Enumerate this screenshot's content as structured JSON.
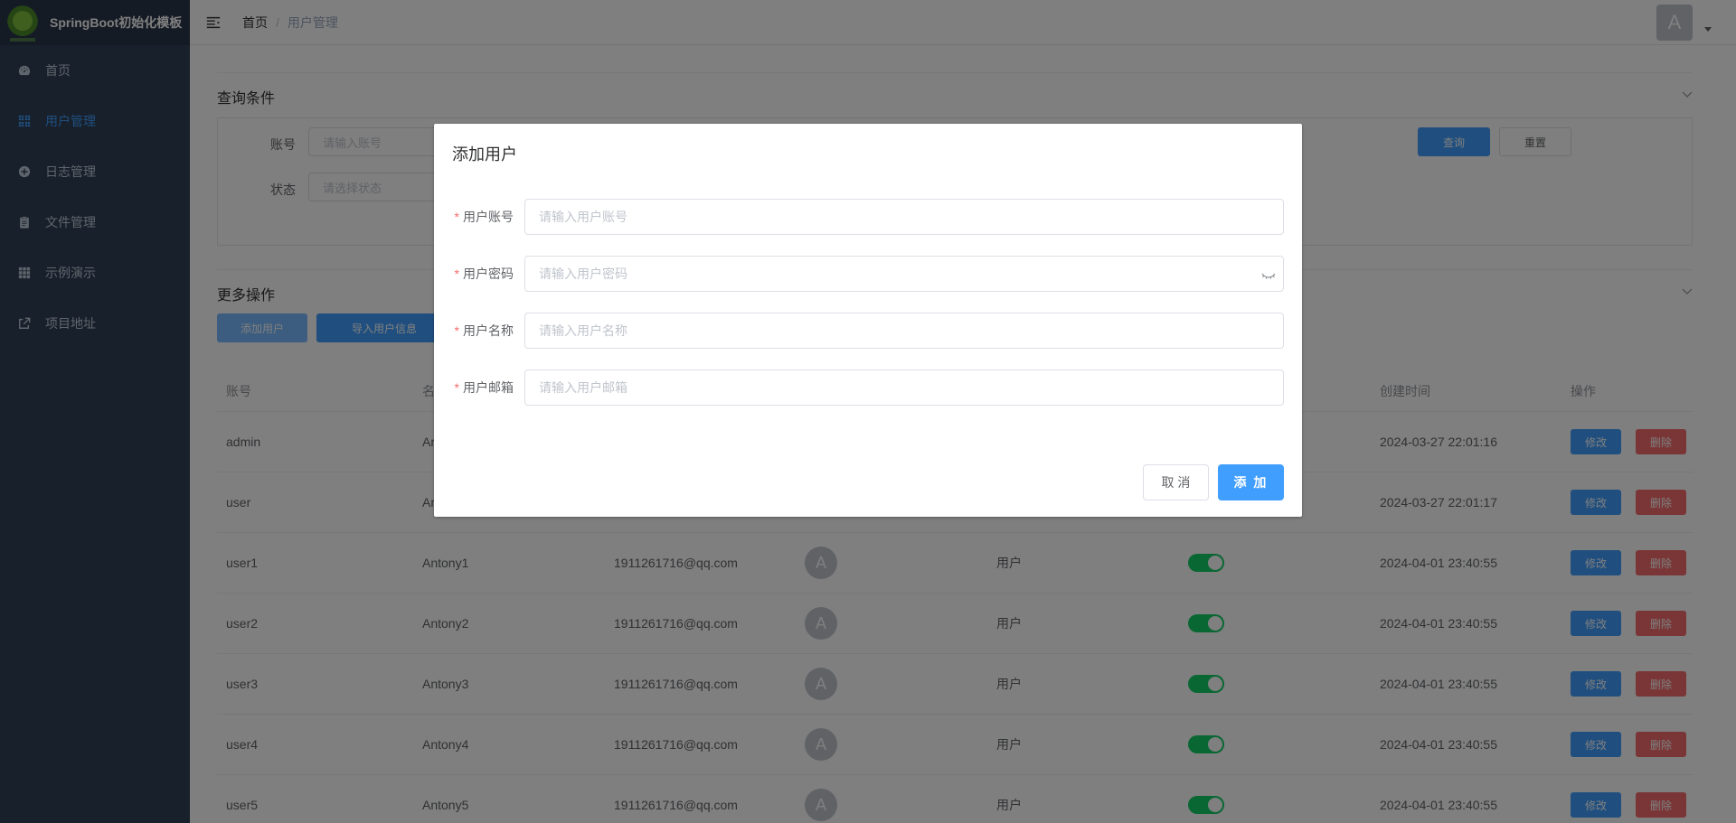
{
  "app": {
    "title": "SpringBoot初始化模板"
  },
  "sidebar": {
    "items": [
      {
        "label": "首页",
        "icon": "dashboard-icon",
        "active": false
      },
      {
        "label": "用户管理",
        "icon": "grid-icon",
        "active": true
      },
      {
        "label": "日志管理",
        "icon": "circle-plus-icon",
        "active": false
      },
      {
        "label": "文件管理",
        "icon": "clipboard-icon",
        "active": false
      },
      {
        "label": "示例演示",
        "icon": "apps-icon",
        "active": false
      },
      {
        "label": "项目地址",
        "icon": "external-link-icon",
        "active": false
      }
    ]
  },
  "header": {
    "breadcrumb": {
      "home": "首页",
      "separator": "/",
      "current": "用户管理"
    },
    "avatar_letter": "A"
  },
  "query": {
    "title": "查询条件",
    "account_label": "账号",
    "account_placeholder": "请输入账号",
    "status_label": "状态",
    "status_placeholder": "请选择状态",
    "search_button": "查询",
    "reset_button": "重置"
  },
  "more_ops": {
    "title": "更多操作",
    "add_user_button": "添加用户",
    "import_button": "导入用户信息"
  },
  "table": {
    "headers": [
      "账号",
      "名",
      "",
      "",
      "",
      "",
      "创建时间",
      "操作"
    ],
    "edit_label": "修改",
    "delete_label": "删除",
    "rows": [
      {
        "account": "admin",
        "name": "Ar",
        "email": "",
        "avatar": "",
        "role": "",
        "created": "2024-03-27 22:01:16"
      },
      {
        "account": "user",
        "name": "Ar",
        "email": "",
        "avatar": "",
        "role": "",
        "created": "2024-03-27 22:01:17"
      },
      {
        "account": "user1",
        "name": "Antony1",
        "email": "1911261716@qq.com",
        "avatar": "A",
        "role": "用户",
        "created": "2024-04-01 23:40:55"
      },
      {
        "account": "user2",
        "name": "Antony2",
        "email": "1911261716@qq.com",
        "avatar": "A",
        "role": "用户",
        "created": "2024-04-01 23:40:55"
      },
      {
        "account": "user3",
        "name": "Antony3",
        "email": "1911261716@qq.com",
        "avatar": "A",
        "role": "用户",
        "created": "2024-04-01 23:40:55"
      },
      {
        "account": "user4",
        "name": "Antony4",
        "email": "1911261716@qq.com",
        "avatar": "A",
        "role": "用户",
        "created": "2024-04-01 23:40:55"
      },
      {
        "account": "user5",
        "name": "Antony5",
        "email": "1911261716@qq.com",
        "avatar": "A",
        "role": "用户",
        "created": "2024-04-01 23:40:55"
      }
    ]
  },
  "dialog": {
    "title": "添加用户",
    "fields": [
      {
        "label": "用户账号",
        "placeholder": "请输入用户账号"
      },
      {
        "label": "用户密码",
        "placeholder": "请输入用户密码"
      },
      {
        "label": "用户名称",
        "placeholder": "请输入用户名称"
      },
      {
        "label": "用户邮箱",
        "placeholder": "请输入用户邮箱"
      }
    ],
    "required_mark": "*",
    "cancel_button": "取 消",
    "add_button": "添 加"
  },
  "colors": {
    "sidebar_bg": "#304156",
    "primary": "#409eff",
    "danger": "#f56c6c",
    "success": "#13ce66"
  }
}
